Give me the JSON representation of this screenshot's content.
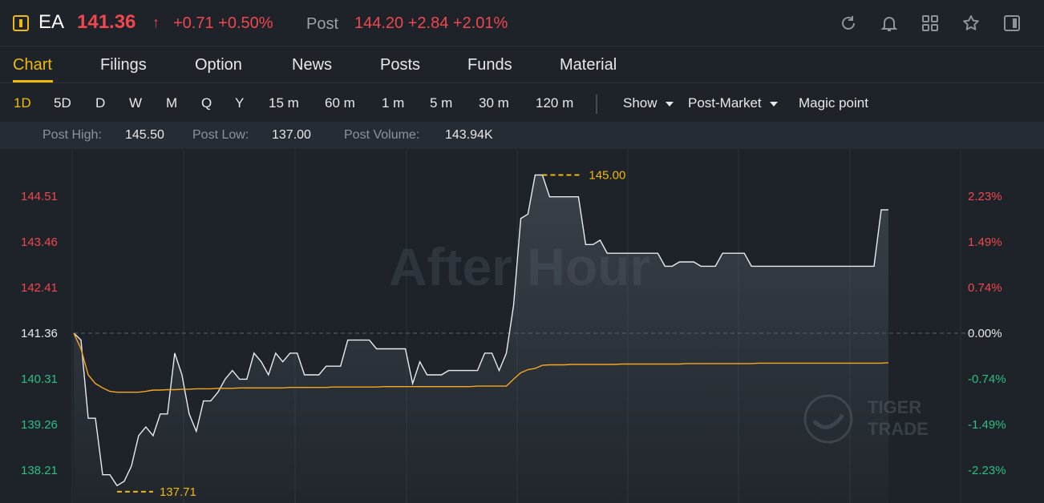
{
  "header": {
    "ticker": "EA",
    "price": "141.36",
    "arrow": "↑",
    "change": "+0.71 +0.50%",
    "post_label": "Post",
    "post_values": "144.20 +2.84 +2.01%",
    "icons": [
      "refresh-icon",
      "bell-icon",
      "grid-icon",
      "star-icon",
      "panel-icon"
    ],
    "colors": {
      "up": "#f0474f",
      "down": "#2ebd85",
      "accent": "#f0b90b"
    }
  },
  "tabs": [
    "Chart",
    "Filings",
    "Option",
    "News",
    "Posts",
    "Funds",
    "Material"
  ],
  "periods": [
    "1D",
    "5D",
    "D",
    "W",
    "M",
    "Q",
    "Y",
    "15 m",
    "60 m",
    "1 m",
    "5 m",
    "30 m",
    "120 m"
  ],
  "options": {
    "show": "Show",
    "session": "Post-Market",
    "magic": "Magic point"
  },
  "stats": {
    "high_label": "Post High:",
    "high": "145.50",
    "low_label": "Post Low:",
    "low": "137.00",
    "volume_label": "Post Volume:",
    "volume": "143.94K"
  },
  "chart_data": {
    "type": "line",
    "watermark": "After Hour",
    "brand": [
      "TIGER",
      "TRADE"
    ],
    "reference_price": 141.36,
    "y_ticks_left": [
      "144.51",
      "143.46",
      "142.41",
      "141.36",
      "140.31",
      "139.26",
      "138.21"
    ],
    "y_ticks_right": [
      "2.23%",
      "1.49%",
      "0.74%",
      "0.00%",
      "-0.74%",
      "-1.49%",
      "-2.23%"
    ],
    "ylim": [
      137.45,
      145.6
    ],
    "high_marker": "145.00",
    "low_marker": "137.71",
    "series": [
      {
        "type": "price",
        "color": "#e9ecef",
        "values": [
          141.36,
          141.2,
          139.4,
          139.4,
          138.1,
          138.1,
          137.85,
          137.95,
          138.3,
          139.0,
          139.2,
          139.0,
          139.5,
          139.5,
          140.9,
          140.4,
          139.5,
          139.1,
          139.8,
          139.8,
          140.0,
          140.3,
          140.5,
          140.3,
          140.3,
          140.9,
          140.7,
          140.4,
          140.9,
          140.7,
          140.9,
          140.9,
          140.4,
          140.4,
          140.4,
          140.6,
          140.6,
          140.6,
          141.2,
          141.2,
          141.2,
          141.2,
          141.0,
          141.0,
          141.0,
          141.0,
          141.0,
          140.2,
          140.7,
          140.4,
          140.4,
          140.4,
          140.5,
          140.5,
          140.5,
          140.5,
          140.5,
          140.9,
          140.9,
          140.5,
          140.9,
          142.0,
          144.0,
          144.1,
          145.0,
          145.0,
          144.5,
          144.5,
          144.5,
          144.5,
          144.5,
          143.4,
          143.4,
          143.5,
          143.2,
          143.2,
          143.2,
          143.2,
          143.2,
          143.2,
          143.2,
          143.2,
          142.9,
          142.9,
          143.0,
          143.0,
          143.0,
          142.9,
          142.9,
          142.9,
          143.2,
          143.2,
          143.2,
          143.2,
          142.9,
          142.9,
          142.9,
          142.9,
          142.9,
          142.9,
          142.9,
          142.9,
          142.9,
          142.9,
          142.9,
          142.9,
          142.9,
          142.9,
          142.9,
          142.9,
          142.9,
          142.9,
          144.2,
          144.2
        ]
      },
      {
        "type": "average",
        "color": "#f5a623",
        "values": [
          141.36,
          141.0,
          140.4,
          140.2,
          140.1,
          140.02,
          140.0,
          140.0,
          140.0,
          140.0,
          140.02,
          140.05,
          140.05,
          140.06,
          140.06,
          140.07,
          140.07,
          140.08,
          140.08,
          140.08,
          140.09,
          140.09,
          140.09,
          140.1,
          140.1,
          140.1,
          140.1,
          140.1,
          140.1,
          140.1,
          140.11,
          140.11,
          140.11,
          140.11,
          140.11,
          140.11,
          140.12,
          140.12,
          140.12,
          140.12,
          140.12,
          140.12,
          140.12,
          140.13,
          140.13,
          140.13,
          140.13,
          140.13,
          140.13,
          140.13,
          140.13,
          140.13,
          140.13,
          140.13,
          140.13,
          140.13,
          140.14,
          140.14,
          140.14,
          140.14,
          140.14,
          140.3,
          140.45,
          140.52,
          140.55,
          140.62,
          140.63,
          140.63,
          140.63,
          140.64,
          140.64,
          140.64,
          140.64,
          140.64,
          140.64,
          140.64,
          140.65,
          140.65,
          140.65,
          140.65,
          140.65,
          140.65,
          140.65,
          140.65,
          140.65,
          140.66,
          140.66,
          140.66,
          140.66,
          140.66,
          140.66,
          140.66,
          140.66,
          140.66,
          140.66,
          140.67,
          140.67,
          140.67,
          140.67,
          140.67,
          140.67,
          140.67,
          140.67,
          140.67,
          140.67,
          140.67,
          140.67,
          140.67,
          140.67,
          140.67,
          140.67,
          140.67,
          140.67,
          140.68
        ]
      }
    ]
  }
}
